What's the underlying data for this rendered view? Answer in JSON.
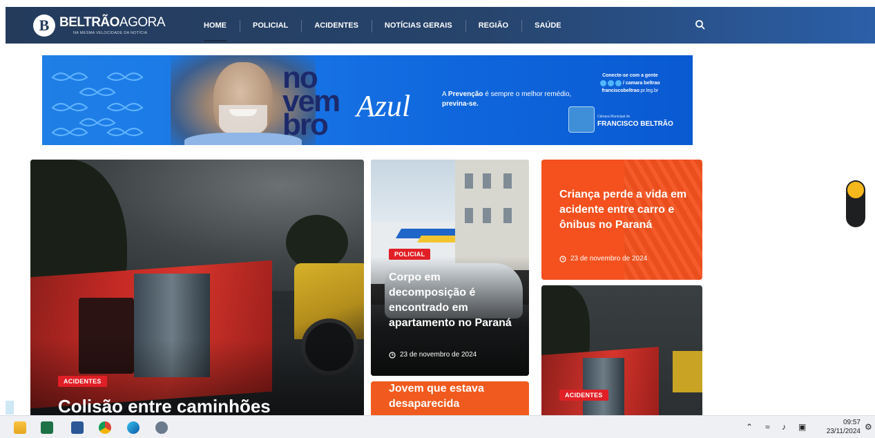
{
  "header": {
    "logo_bold": "BELTRÃO",
    "logo_light": "AGORA",
    "logo_tagline": "NA MESMA VELOCIDADE DA NOTÍCIA",
    "nav": [
      "HOME",
      "POLICIAL",
      "ACIDENTES",
      "NOTÍCIAS GERAIS",
      "REGIÃO",
      "SAÚDE"
    ],
    "active_nav": "HOME",
    "search_icon": "search-icon"
  },
  "banner": {
    "word_line1": "no",
    "word_line2": "vem",
    "word_line3": "bro",
    "word_script": "Azul",
    "prevention_text_1": "A ",
    "prevention_bold_1": "Prevenção",
    "prevention_text_2": " é sempre o melhor remédio, ",
    "prevention_bold_2": "previna-se.",
    "connect_title": "Conecte-se com a gente",
    "connect_handle": "/ camara beltrao",
    "connect_site_bold": "franciscobeltrao",
    "connect_site_rest": ".pr.leg.br",
    "camara_small": "Câmara Municipal de",
    "camara_name": "FRANCISCO BELTRÃO"
  },
  "articles": {
    "main": {
      "category": "ACIDENTES",
      "title": "Colisão entre caminhões"
    },
    "mid_top": {
      "category": "POLICIAL",
      "title": "Corpo em decomposição é encontrado em apartamento no Paraná",
      "date": "23 de novembro de 2024"
    },
    "mid_bottom": {
      "title": "Jovem que estava desaparecida"
    },
    "right_top": {
      "title": "Criança perde a vida em acidente entre carro e ônibus no Paraná",
      "date": "23 de novembro de 2024"
    },
    "right_bottom": {
      "category": "ACIDENTES"
    }
  },
  "colors": {
    "nav_bg": "#243b5c",
    "badge_red": "#e11f26",
    "orange_card": "#f4511e",
    "banner_blue": "#1a78e8"
  },
  "taskbar": {
    "apps": [
      "file-explorer-icon",
      "excel-icon",
      "word-icon",
      "chrome-icon",
      "edge-icon",
      "settings-icon"
    ],
    "time": "09:57",
    "date": "23/11/2024"
  }
}
